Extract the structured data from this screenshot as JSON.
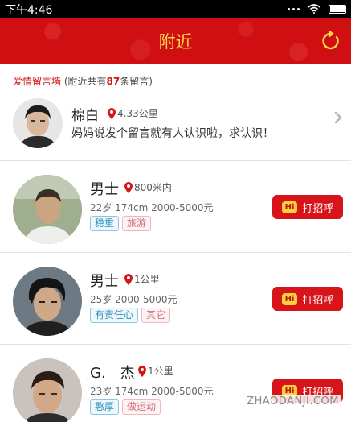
{
  "status_bar": {
    "time": "下午4:46"
  },
  "header": {
    "title": "附近",
    "refresh_icon": "refresh-icon"
  },
  "notice": {
    "wall": "爱情留言墙",
    "prefix": "(附近共有",
    "count": "87",
    "suffix": "条留言)"
  },
  "message": {
    "name": "棉白",
    "distance": "4.33公里",
    "text": "妈妈说发个留言就有人认识啦，求认识！"
  },
  "greet_label": "打招呼",
  "greet_hi": "Hi",
  "users": [
    {
      "name": "男士",
      "distance": "800米内",
      "info": "22岁 174cm 2000-5000元",
      "tags": [
        "稳重",
        "旅游"
      ]
    },
    {
      "name": "男士",
      "distance": "1公里",
      "info": "25岁 2000-5000元",
      "tags": [
        "有责任心",
        "其它"
      ]
    },
    {
      "name": "G.　杰",
      "distance": "1公里",
      "info": "23岁 174cm 2000-5000元",
      "tags": [
        "憨厚",
        "做运动"
      ]
    }
  ],
  "watermark": "ZHAODANJI.COM",
  "colors": {
    "brand_red": "#cf0f12",
    "title_yellow": "#ffd54a",
    "tag_blue": "#2f8fb8",
    "tag_pink": "#d0707b"
  }
}
